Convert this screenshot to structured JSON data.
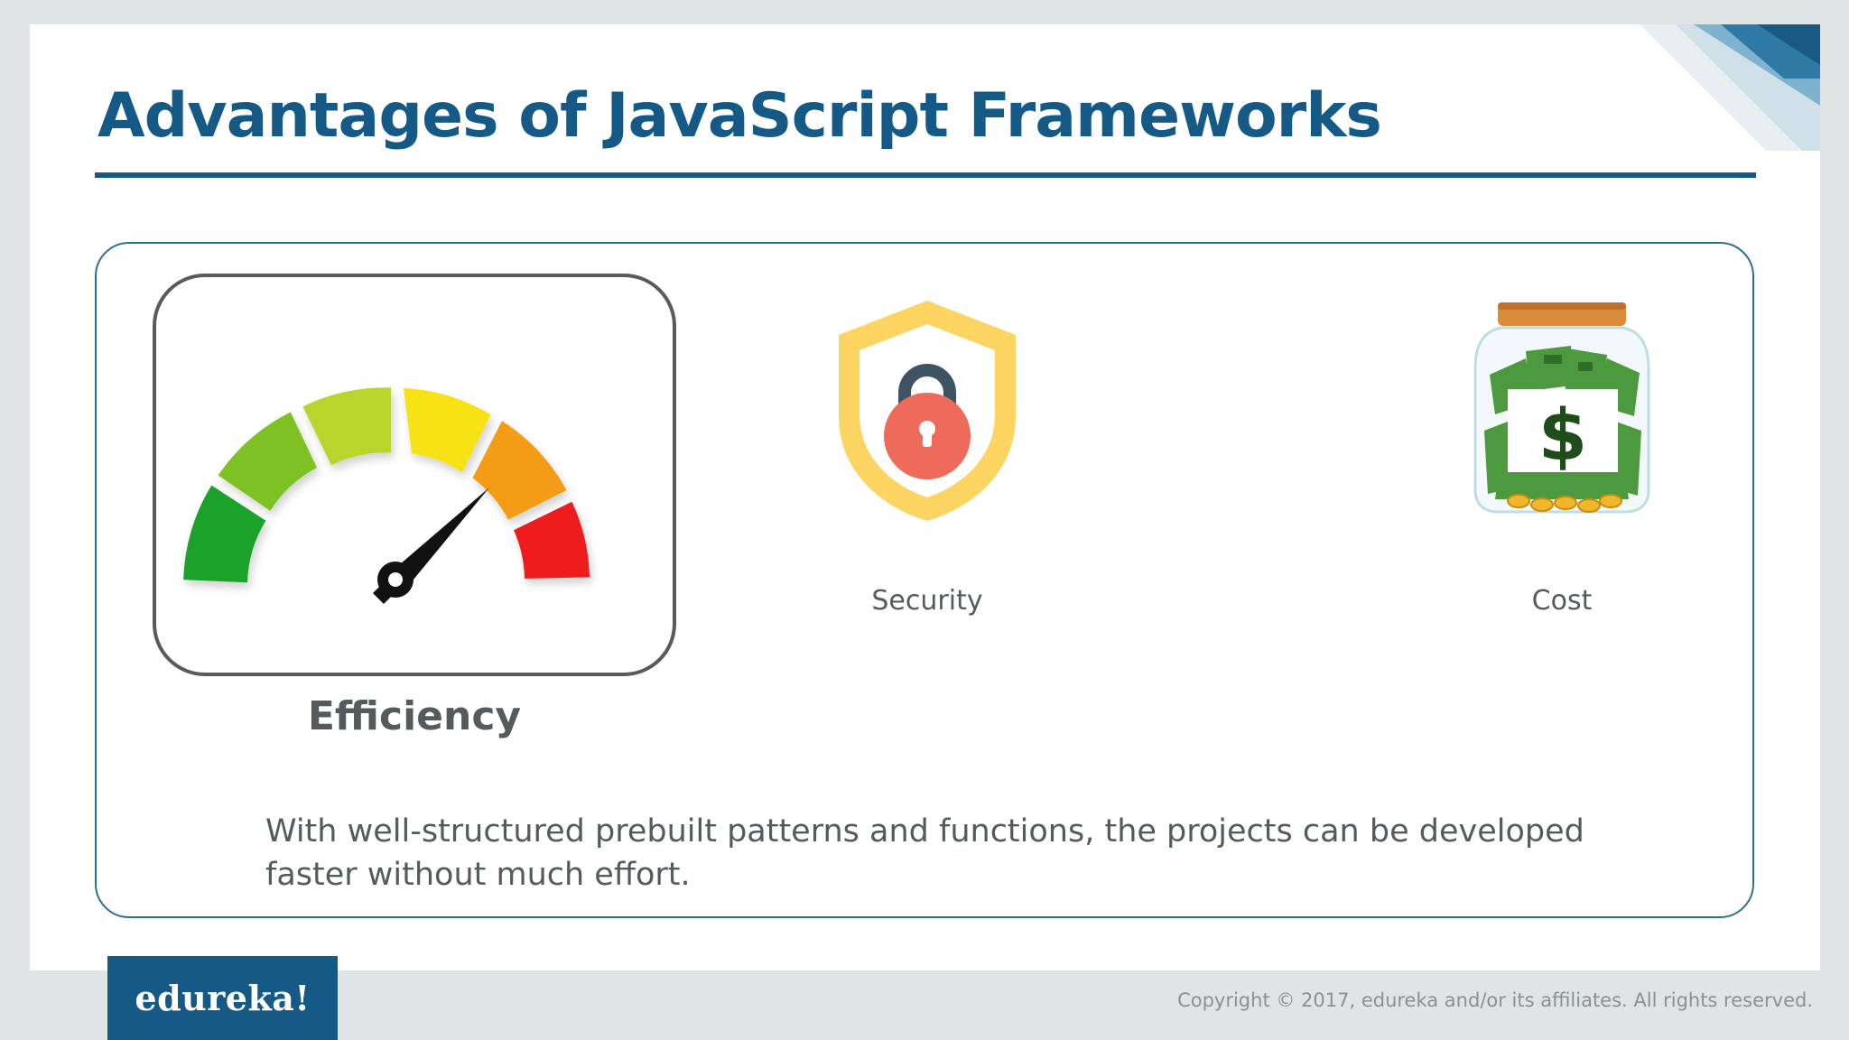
{
  "slide": {
    "title": "Advantages of JavaScript Frameworks"
  },
  "features": {
    "efficiency": {
      "label": "Efficiency",
      "icon": "speedometer-icon"
    },
    "security": {
      "label": "Security",
      "icon": "shield-lock-icon"
    },
    "cost": {
      "label": "Cost",
      "icon": "money-jar-icon"
    }
  },
  "description": "With well-structured prebuilt patterns and functions, the projects can be developed faster without much effort.",
  "footer": {
    "logo": "edureka!",
    "copyright": "Copyright © 2017, edureka and/or its affiliates. All rights reserved."
  },
  "colors": {
    "brand_blue": "#155a86",
    "text_gray": "#555a5c",
    "background": "#dfe5e4"
  }
}
